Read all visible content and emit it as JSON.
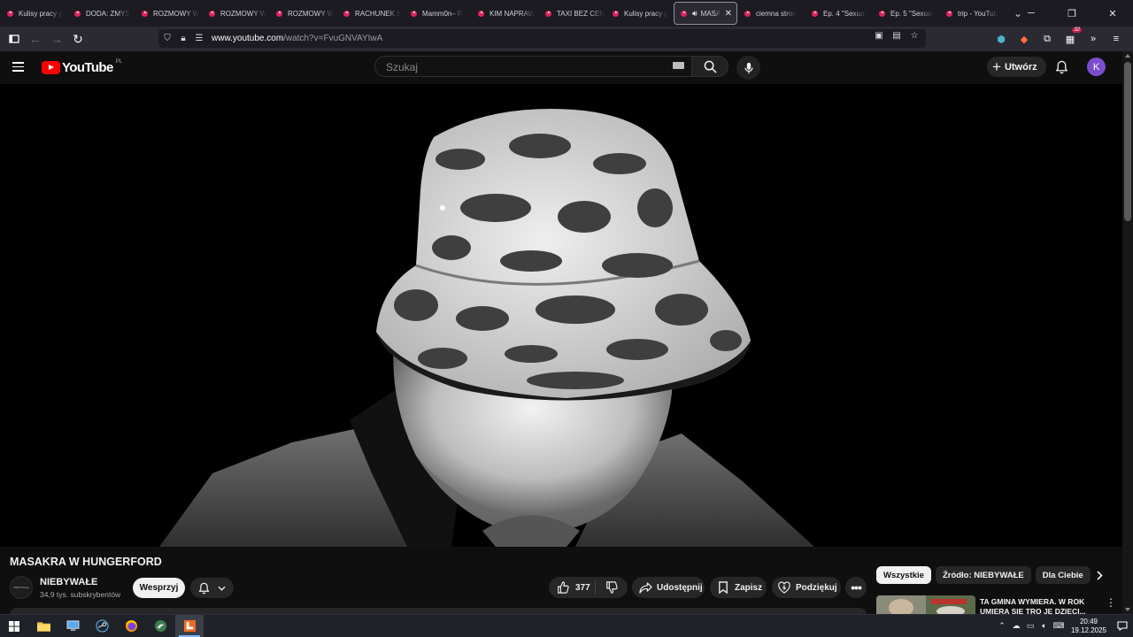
{
  "browser": {
    "tabs": [
      {
        "title": "Kulisy pracy g"
      },
      {
        "title": "DODA: ZMYŚ"
      },
      {
        "title": "ROZMOWY W"
      },
      {
        "title": "ROZMOWY W"
      },
      {
        "title": "ROZMOWY W"
      },
      {
        "title": "RACHUNEK S"
      },
      {
        "title": "Mamm0n– R"
      },
      {
        "title": "KIM NAPRAW"
      },
      {
        "title": "TAXI BEZ CEN"
      },
      {
        "title": "Kulisy pracy g"
      },
      {
        "title": "MASA",
        "active": true,
        "playing_audio": true
      },
      {
        "title": "ciemna stron"
      },
      {
        "title": "Ep. 4 \"Sexual"
      },
      {
        "title": "Ep. 5 \"Sexual"
      },
      {
        "title": "trip - YouTub"
      }
    ],
    "url_domain": "www.youtube.com",
    "url_path": "/watch?v=FvuGNVAYIwA",
    "extension_badge": "32",
    "accent_tab_favicon": "#e0245e"
  },
  "youtube": {
    "logo_text": "YouTube",
    "region": "PL",
    "search": {
      "placeholder": "Szukaj"
    },
    "create_label": "Utwórz",
    "avatar_letter": "K",
    "avatar_color": "#7c4dce"
  },
  "video": {
    "title": "MASAKRA W HUNGERFORD",
    "channel": {
      "name": "NIEBYWAŁE",
      "subscribers": "34,9 tys. subskrybentów",
      "avatar_text": "NIEBYWAŁE"
    },
    "support_label": "Wesprzyj",
    "likes": "377",
    "share_label": "Udostępnij",
    "save_label": "Zapisz",
    "thanks_label": "Podziękuj"
  },
  "sidebar": {
    "chips": [
      {
        "label": "Wszystkie",
        "active": true
      },
      {
        "label": "Źródło: NIEBYWAŁE"
      },
      {
        "label": "Dla Ciebie"
      }
    ],
    "recommendation": {
      "title": "TA GMINA WYMIERA. W ROK UMIERA SIĘ TRO JE DZIECI..."
    }
  },
  "taskbar": {
    "time": "20:49",
    "date": "19.12.2025",
    "apps": [
      "windows-start",
      "file-explorer",
      "remote-desktop",
      "steam",
      "firefox",
      "bird-app",
      "notes-app"
    ]
  }
}
